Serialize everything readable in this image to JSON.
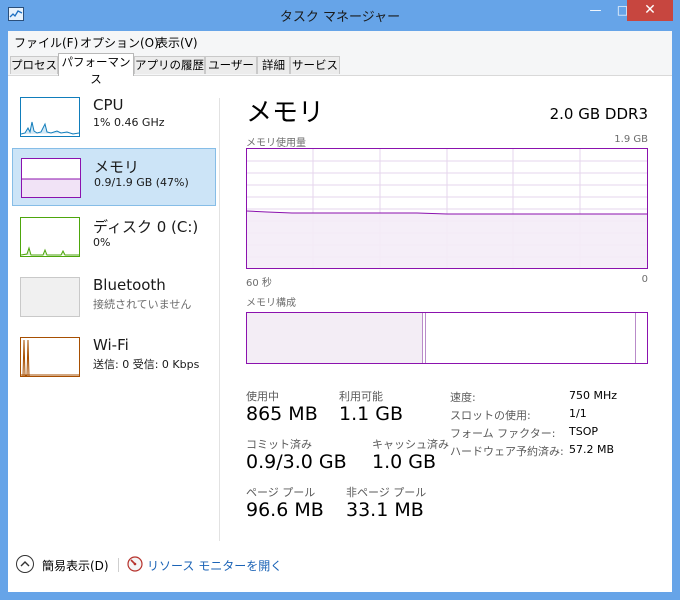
{
  "window": {
    "title": "タスク マネージャー",
    "controls": {
      "minimize": "—",
      "maximize": "□",
      "close": "✕"
    }
  },
  "menu": [
    "ファイル(F)",
    "オプション(O)",
    "表示(V)"
  ],
  "tabs": [
    "プロセス",
    "パフォーマンス",
    "アプリの履歴",
    "ユーザー",
    "詳細",
    "サービス"
  ],
  "active_tab": "パフォーマンス",
  "sidebar": [
    {
      "title": "CPU",
      "sub": "1% 0.46 GHz",
      "color": "#117dbb",
      "icon": "cpu-graph-thumbnail"
    },
    {
      "title": "メモリ",
      "sub": "0.9/1.9 GB (47%)",
      "color": "#8b12ae",
      "icon": "memory-graph-thumbnail",
      "selected": true
    },
    {
      "title": "ディスク 0 (C:)",
      "sub": "0%",
      "color": "#4da60c",
      "icon": "disk-graph-thumbnail"
    },
    {
      "title": "Bluetooth",
      "sub": "接続されていません",
      "color": "#c9c9c9",
      "icon": "bluetooth-graph-thumbnail"
    },
    {
      "title": "Wi-Fi",
      "sub": "送信: 0 受信: 0 Kbps",
      "color": "#a74f01",
      "icon": "wifi-graph-thumbnail"
    }
  ],
  "main": {
    "title": "メモリ",
    "spec": "2.0 GB DDR3",
    "usage_graph": {
      "label": "メモリ使用量",
      "max": "1.9 GB",
      "x_left": "60 秒",
      "x_right": "0"
    },
    "composition_label": "メモリ構成",
    "stats": [
      {
        "label": "使用中",
        "value": "865 MB"
      },
      {
        "label": "利用可能",
        "value": "1.1 GB"
      },
      {
        "label": "コミット済み",
        "value": "0.9/3.0 GB"
      },
      {
        "label": "キャッシュ済み",
        "value": "1.0 GB"
      },
      {
        "label": "ページ プール",
        "value": "96.6 MB"
      },
      {
        "label": "非ページ プール",
        "value": "33.1 MB"
      }
    ],
    "details": [
      {
        "label": "速度:",
        "value": "750 MHz"
      },
      {
        "label": "スロットの使用:",
        "value": "1/1"
      },
      {
        "label": "フォーム ファクター:",
        "value": "TSOP"
      },
      {
        "label": "ハードウェア予約済み:",
        "value": "57.2 MB"
      }
    ]
  },
  "footer": {
    "fewer_details": "簡易表示(D)",
    "resource_monitor": "リソース モニターを開く"
  },
  "accent_color": "#8b12ae",
  "selection_color": "#cce4f7"
}
